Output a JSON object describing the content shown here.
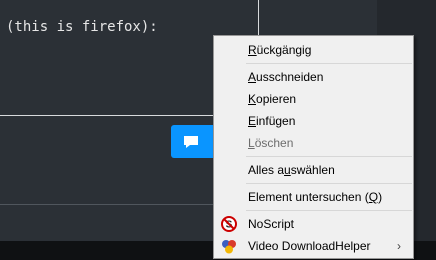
{
  "editor": {
    "code_line": "(this is firefox):"
  },
  "context_menu": {
    "items": [
      {
        "pre": "",
        "key": "R",
        "post": "ückgängig"
      },
      {
        "pre": "",
        "key": "A",
        "post": "usschneiden"
      },
      {
        "pre": "",
        "key": "K",
        "post": "opieren"
      },
      {
        "pre": "",
        "key": "E",
        "post": "infügen"
      },
      {
        "pre": "",
        "key": "L",
        "post": "öschen"
      },
      {
        "pre": "Alles a",
        "key": "u",
        "post": "swählen"
      },
      {
        "pre": "Element untersuchen (",
        "key": "Q",
        "post": ")"
      },
      {
        "pre": "NoScript",
        "key": "",
        "post": ""
      },
      {
        "pre": "Video DownloadHelper",
        "key": "",
        "post": ""
      }
    ],
    "submenu_arrow": "›"
  },
  "icons": {
    "post_button": "comment-icon",
    "noscript": "noscript-icon",
    "video_downloadhelper": "video-downloadhelper-icon"
  },
  "colors": {
    "background": "#2b3036",
    "accent": "#0a95ff",
    "menu_bg": "#f0f0f0",
    "disabled_text": "#6d6d6d"
  }
}
